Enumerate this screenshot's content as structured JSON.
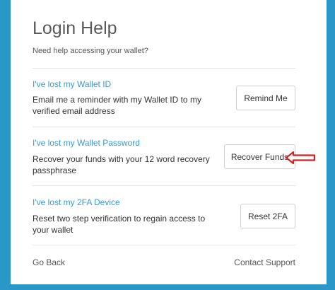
{
  "header": {
    "title": "Login Help",
    "subtitle": "Need help accessing your wallet?"
  },
  "sections": [
    {
      "title": "I've lost my Wallet ID",
      "desc_line1": "Email me a reminder with my Wallet ID to my",
      "desc_line2": "verified email address",
      "button": "Remind Me"
    },
    {
      "title": "I've lost my Wallet Password",
      "desc_line1": "Recover your funds with your 12 word recovery",
      "desc_line2": "passphrase",
      "button": "Recover Funds"
    },
    {
      "title": "I've lost my 2FA Device",
      "desc_line1": "Reset two step verification to regain access to",
      "desc_line2": "your wallet",
      "button": "Reset 2FA"
    }
  ],
  "footer": {
    "back": "Go Back",
    "support": "Contact Support"
  },
  "colors": {
    "background": "#2a97c9",
    "link": "#3a9ad0",
    "arrow": "#d42020"
  },
  "annotation": {
    "icon": "red-arrow-icon"
  }
}
